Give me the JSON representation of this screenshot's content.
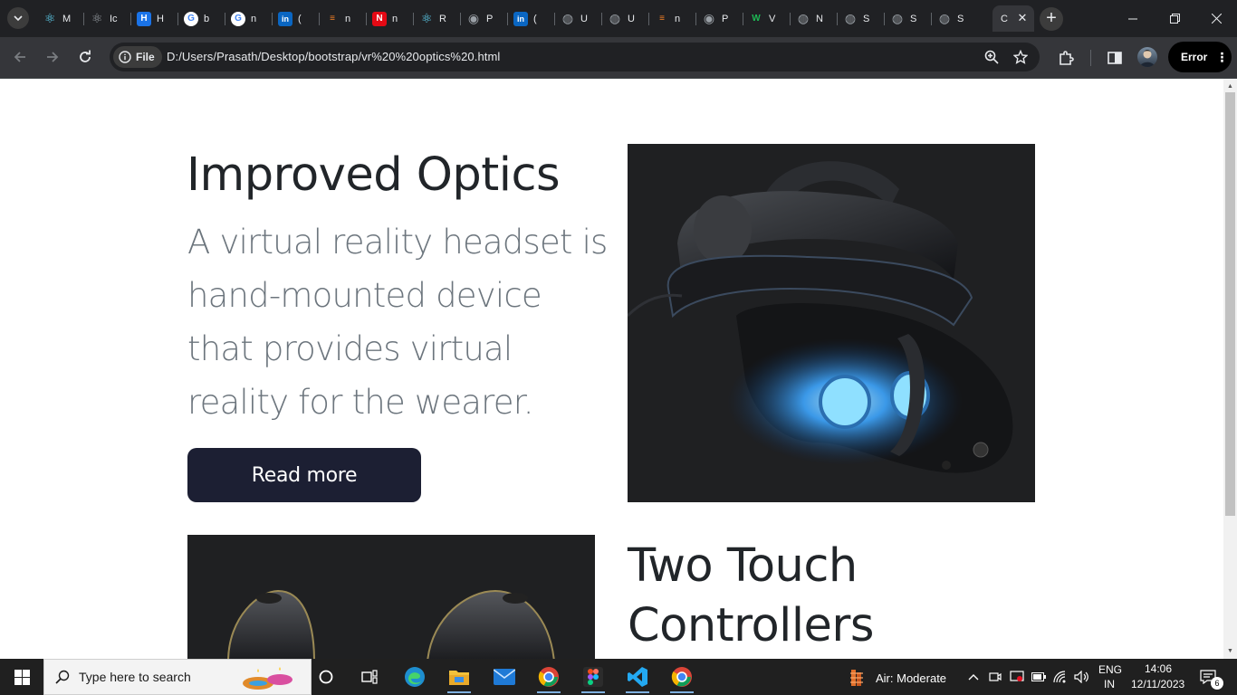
{
  "browser": {
    "tabs": [
      {
        "icon": "react-icon",
        "title": "M",
        "color": "#61dafb"
      },
      {
        "icon": "react-icon",
        "title": "Ic",
        "color": "#9aa0a6"
      },
      {
        "icon": "h-icon",
        "title": "H",
        "color": "#1a73e8"
      },
      {
        "icon": "google-icon",
        "title": "b",
        "color": "#ffffff"
      },
      {
        "icon": "google-icon",
        "title": "n",
        "color": "#ffffff"
      },
      {
        "icon": "linkedin-icon",
        "title": "(",
        "color": "#0a66c2"
      },
      {
        "icon": "stackoverflow-icon",
        "title": "n",
        "color": "#f48024"
      },
      {
        "icon": "n-icon",
        "title": "n",
        "color": "#e50914"
      },
      {
        "icon": "react-icon",
        "title": "R",
        "color": "#61dafb"
      },
      {
        "icon": "github-icon",
        "title": "P",
        "color": "#9aa0a6"
      },
      {
        "icon": "linkedin-icon",
        "title": "(",
        "color": "#0a66c2"
      },
      {
        "icon": "globe-icon",
        "title": "U",
        "color": "#9aa0a6"
      },
      {
        "icon": "globe-icon",
        "title": "U",
        "color": "#9aa0a6"
      },
      {
        "icon": "stackoverflow-icon",
        "title": "n",
        "color": "#f48024"
      },
      {
        "icon": "github-icon",
        "title": "P",
        "color": "#9aa0a6"
      },
      {
        "icon": "w-icon",
        "title": "V",
        "color": "#1db954"
      },
      {
        "icon": "globe-icon",
        "title": "N",
        "color": "#9aa0a6"
      },
      {
        "icon": "globe-icon",
        "title": "S",
        "color": "#9aa0a6"
      },
      {
        "icon": "globe-icon",
        "title": "S",
        "color": "#9aa0a6"
      },
      {
        "icon": "globe-icon",
        "title": "S",
        "color": "#9aa0a6"
      }
    ],
    "active_tab_title": "C",
    "security_chip": "File",
    "url": "D:/Users/Prasath/Desktop/bootstrap/vr%20%20optics%20.html",
    "profile_button": "Error"
  },
  "page": {
    "section1": {
      "title": "Improved Optics",
      "lead_lines": [
        "A virtual reality headset is",
        "hand-mounted device",
        "that provides virtual",
        "reality for the wearer."
      ],
      "button": "Read more"
    },
    "section2": {
      "title_lines": [
        "Two Touch",
        "Controllers"
      ]
    }
  },
  "taskbar": {
    "search_placeholder": "Type here to search",
    "weather": "Air: Moderate",
    "language": [
      "ENG",
      "IN"
    ],
    "time": "14:06",
    "date": "12/11/2023",
    "notifications": "6"
  }
}
